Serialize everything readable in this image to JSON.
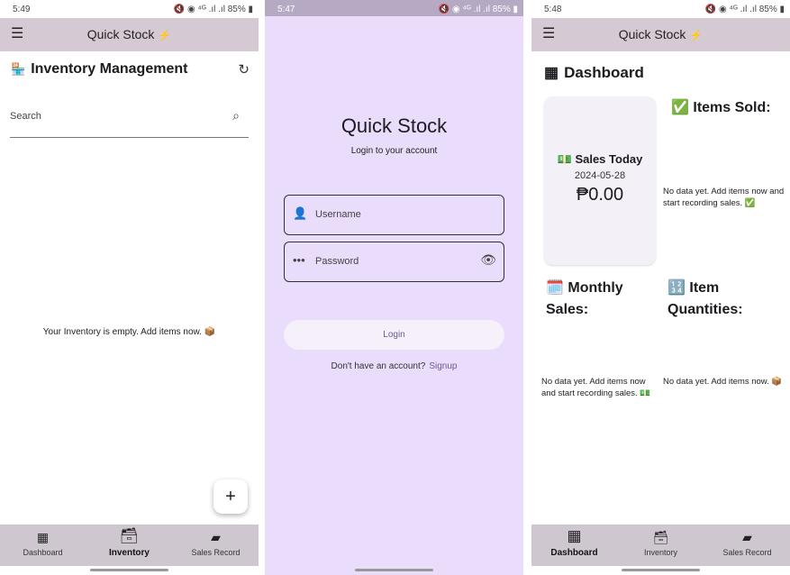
{
  "screen1": {
    "status": {
      "time": "5:49",
      "icons": "🔇 ◉ ⁴ᴳ .ıl .ıl 85% ▮"
    },
    "appbar": {
      "menu": "☰",
      "title": "Quick Stock",
      "bolt": "⚡"
    },
    "header": {
      "icon": "🏪",
      "title": "Inventory Management",
      "refresh": "↻"
    },
    "search": {
      "placeholder": "Search",
      "icon": "⌕"
    },
    "empty_message": "Your Inventory is empty. Add items now. 📦",
    "fab": "+",
    "nav": [
      {
        "icon": "▦",
        "label": "Dashboard"
      },
      {
        "icon": "🗃",
        "label": "Inventory"
      },
      {
        "icon": "▰",
        "label": "Sales Record"
      }
    ]
  },
  "screen2": {
    "status": {
      "time": "5:47",
      "icons": "🔇 ◉ ⁴ᴳ .ıl .ıl 85% ▮"
    },
    "title": "Quick Stock",
    "subtitle": "Login to your account",
    "username": {
      "icon": "👤",
      "placeholder": "Username"
    },
    "password": {
      "icon": "•••",
      "placeholder": "Password",
      "eye": "👁"
    },
    "login_button": "Login",
    "signup_prompt": "Don't have an account?",
    "signup_link": "Signup"
  },
  "screen3": {
    "status": {
      "time": "5:48",
      "icons": "🔇 ◉ ⁴ᴳ .ıl .ıl 85% ▮"
    },
    "appbar": {
      "menu": "☰",
      "title": "Quick Stock",
      "bolt": "⚡"
    },
    "dashboard": {
      "icon": "▦",
      "title": "Dashboard"
    },
    "sales_today": {
      "title": "💵 Sales Today",
      "date": "2024-05-28",
      "amount": "₱0.00"
    },
    "items_sold": {
      "title": "✅ Items Sold:",
      "message": "No data yet. Add items now and start recording sales. ✅"
    },
    "monthly_sales": {
      "title": "🗓️ Monthly Sales:",
      "message": "No data yet. Add items now and start recording sales. 💵"
    },
    "item_quantities": {
      "title": "🔢 Item Quantities:",
      "message": "No data yet. Add items now. 📦"
    },
    "nav": [
      {
        "icon": "▦",
        "label": "Dashboard"
      },
      {
        "icon": "🗃",
        "label": "Inventory"
      },
      {
        "icon": "▰",
        "label": "Sales Record"
      }
    ]
  }
}
